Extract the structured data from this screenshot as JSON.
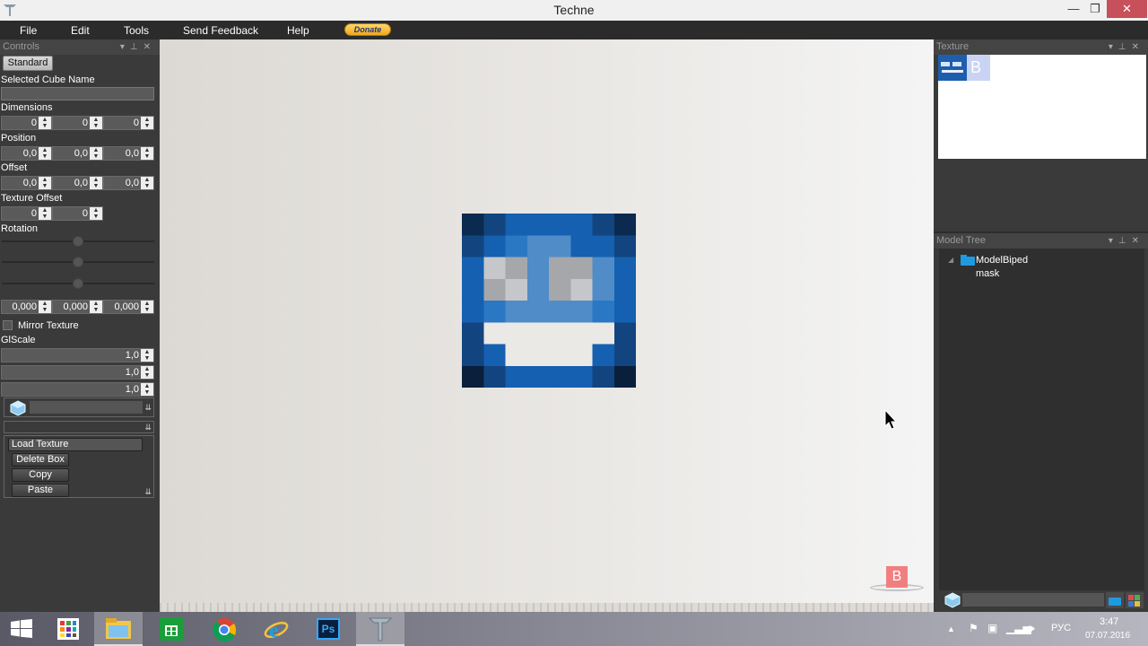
{
  "window": {
    "title": "Techne",
    "min_glyph": "—",
    "max_glyph": "❐",
    "close_glyph": "✕"
  },
  "menu": {
    "file": "File",
    "edit": "Edit",
    "tools": "Tools",
    "feedback": "Send Feedback",
    "help": "Help",
    "donate": "Donate"
  },
  "controls": {
    "panel_title": "Controls",
    "mode_button": "Standard",
    "selected_cube_name_label": "Selected Cube Name",
    "selected_cube_name_value": "",
    "dimensions_label": "Dimensions",
    "dimensions": [
      "0",
      "0",
      "0"
    ],
    "position_label": "Position",
    "position": [
      "0,0",
      "0,0",
      "0,0"
    ],
    "offset_label": "Offset",
    "offset": [
      "0,0",
      "0,0",
      "0,0"
    ],
    "texture_offset_label": "Texture Offset",
    "texture_offset": [
      "0",
      "0"
    ],
    "rotation_label": "Rotation",
    "rotation": [
      "0,000",
      "0,000",
      "0,000"
    ],
    "mirror_texture_label": "Mirror Texture",
    "mirror_texture_checked": false,
    "glscale_label": "GlScale",
    "glscale": [
      "1,0",
      "1,0",
      "1,0"
    ],
    "load_texture": "Load Texture",
    "delete_box": "Delete Box",
    "copy": "Copy",
    "paste": "Paste"
  },
  "texture_panel": {
    "title": "Texture"
  },
  "model_tree": {
    "title": "Model Tree",
    "root": "ModelBiped",
    "child": "mask"
  },
  "viewport": {
    "axis_label": "B"
  },
  "taskbar": {
    "apps": [
      "start-icon",
      "store-tiles-icon",
      "file-explorer-icon",
      "windows-store-icon",
      "chrome-icon",
      "internet-explorer-icon",
      "photoshop-icon",
      "techne-icon"
    ],
    "photoshop_label": "Ps",
    "language": "РУС",
    "time": "3:47",
    "date": "07.07.2016"
  },
  "colors": {
    "accent_close": "#c7505a",
    "mask_blue": "#1560b0",
    "axis_badge": "#f08080"
  }
}
